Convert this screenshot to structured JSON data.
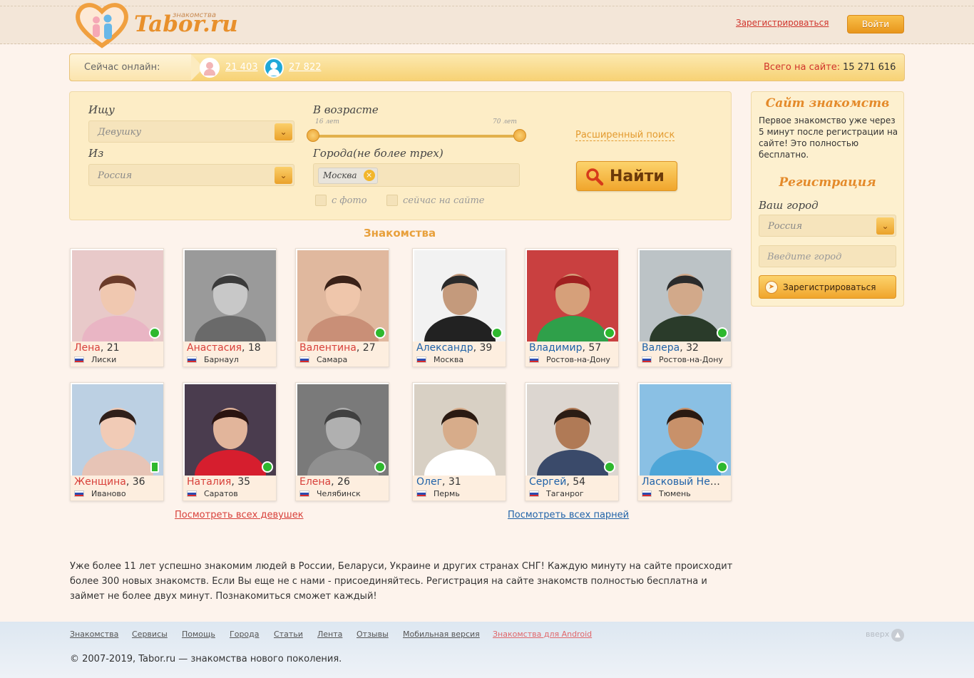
{
  "header": {
    "logo_text": "Tabor.ru",
    "logo_sub": "знакомства",
    "register_link": "Зарегистрироваться",
    "login_button": "Войти"
  },
  "online": {
    "label": "Сейчас онлайн:",
    "women_count": "21 403",
    "men_count": "27 822",
    "total_label": "Всего на сайте:",
    "total_value": "15 271 616"
  },
  "search": {
    "looking_label": "Ищу",
    "looking_value": "Девушку",
    "from_label": "Из",
    "from_value": "Россия",
    "age_label": "В возрасте",
    "age_min": "16 лет",
    "age_max": "70 лет",
    "cities_label": "Города(не более трех)",
    "city_tag": "Москва",
    "with_photo": "с фото",
    "online_now": "сейчас на сайте",
    "advanced_link": "Расширенный поиск",
    "find_button": "Найти"
  },
  "sidebar": {
    "title": "Сайт знакомств",
    "text": "Первое знакомство уже через 5 минут после регистрации на сайте! Это полностью бесплатно.",
    "reg_title": "Регистрация",
    "city_label": "Ваш город",
    "country_value": "Россия",
    "city_placeholder": "Введите город",
    "register_button": "Зарегистрироваться"
  },
  "section_title": "Знакомства",
  "profiles": [
    {
      "name": "Лена",
      "age": ", 21",
      "city": "Лиски"
    },
    {
      "name": "Анастасия",
      "age": ", 18",
      "city": "Барнаул"
    },
    {
      "name": "Валентина",
      "age": ", 27",
      "city": "Самара"
    },
    {
      "name": "Александр",
      "age": ", 39",
      "city": "Москва"
    },
    {
      "name": "Владимир",
      "age": ", 57",
      "city": "Ростов-на-Дону"
    },
    {
      "name": "Валера",
      "age": ", 32",
      "city": "Ростов-на-Дону"
    },
    {
      "name": "Женщина",
      "age": ", 36",
      "city": "Иваново"
    },
    {
      "name": "Наталия",
      "age": ", 35",
      "city": "Саратов"
    },
    {
      "name": "Елена",
      "age": ", 26",
      "city": "Челябинск"
    },
    {
      "name": "Олег",
      "age": ", 31",
      "city": "Пермь"
    },
    {
      "name": "Сергей",
      "age": ", 54",
      "city": "Таганрог"
    },
    {
      "name": "Ласковый Нежн...",
      "age": "",
      "city": "Тюмень"
    }
  ],
  "see_all_women": "Посмотреть всех девушек",
  "see_all_men": "Посмотреть всех парней",
  "about": "Уже более 11 лет успешно знакомим людей в России, Беларуси, Украине и других странах СНГ! Каждую минуту на сайте происходит более 300 новых знакомств. Если Вы еще не с нами - присоединяйтесь. Регистрация на сайте знакомств полностью бесплатна и займет не более двух минут. Познакомиться сможет каждый!",
  "footer": {
    "nav": [
      "Знакомства",
      "Сервисы",
      "Помощь",
      "Города",
      "Статьи",
      "Лента",
      "Отзывы",
      "Мобильная версия",
      "Знакомства для Android"
    ],
    "up": "вверх",
    "copyright": "© 2007-2019, Tabor.ru — знакомства нового поколения."
  },
  "colors": {
    "accent": "#f0a52c",
    "female_name": "#d8403a",
    "male_name": "#1f62a8"
  }
}
